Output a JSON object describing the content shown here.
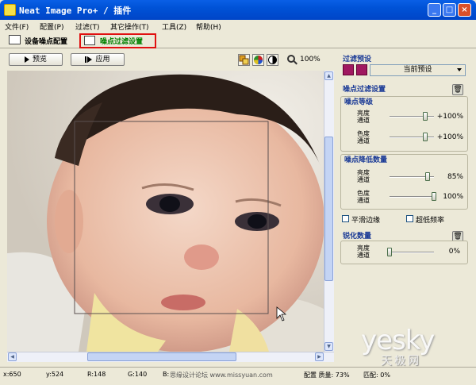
{
  "window": {
    "title": "Neat Image Pro+ / 插件",
    "controls": [
      "minimize",
      "maximize",
      "close"
    ]
  },
  "menu": [
    "文件(F)",
    "配置(P)",
    "过滤(T)",
    "其它操作(T)",
    "工具(Z)",
    "帮助(H)"
  ],
  "tabs": [
    {
      "label": "设备噪点配置",
      "icon": "camera-profile-icon",
      "active": false
    },
    {
      "label": "噪点过滤设置",
      "icon": "filter-settings-icon",
      "active": true,
      "highlight": "#e01010"
    }
  ],
  "toolbar": {
    "preview_label": "预览",
    "apply_label": "应用",
    "zoom": "100%"
  },
  "filter_preset": {
    "title": "过滤预设",
    "selected": "当前预设"
  },
  "noise_filter": {
    "title": "噪点过滤设置",
    "levels": {
      "title": "噪点等级",
      "rows": [
        {
          "label": "亮度通道",
          "value": "+100%",
          "level": 0.85
        },
        {
          "label": "色度通道",
          "value": "+100%",
          "level": 0.85
        }
      ]
    },
    "reduction": {
      "title": "噪点降低数量",
      "rows": [
        {
          "label": "亮度通道",
          "value": "85%",
          "level": 0.85
        },
        {
          "label": "色度通道",
          "value": "100%",
          "level": 1.0
        }
      ]
    },
    "options": [
      {
        "label": "平滑边缘",
        "checked": false
      },
      {
        "label": "超低频率",
        "checked": false
      }
    ]
  },
  "sharpening": {
    "title": "锐化数量",
    "rows": [
      {
        "label": "亮度通道",
        "value": "0%",
        "level": 0.0
      }
    ]
  },
  "status": {
    "x": "x:650",
    "y": "y:524",
    "r": "R:148",
    "g": "G:140",
    "b": "B:",
    "mid": "配置 质量: 73%",
    "match": "匹配: 0%",
    "overlay": "思缘设计论坛 www.missyuan.com"
  },
  "watermark": {
    "brand": "yesky",
    "sub": "天极网"
  },
  "colors": {
    "titlebar": "#0052d6",
    "section_title": "#1a3a96",
    "active_tab_text": "#008000",
    "highlight": "#e01010"
  }
}
